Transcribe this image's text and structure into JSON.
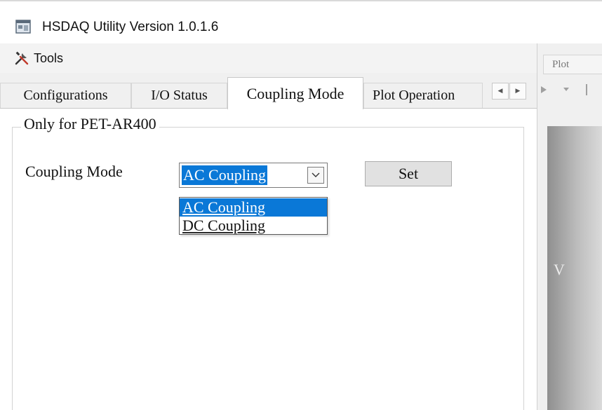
{
  "window": {
    "title": "HSDAQ Utility Version 1.0.1.6"
  },
  "menu": {
    "tools_label": "Tools"
  },
  "tabs": [
    {
      "label": "Configurations",
      "active": false
    },
    {
      "label": "I/O Status",
      "active": false
    },
    {
      "label": "Coupling Mode",
      "active": true
    },
    {
      "label": "Plot Operation",
      "active": false
    }
  ],
  "tab_scroll": {
    "left": "◀",
    "right": "▶"
  },
  "group": {
    "legend": "Only for PET-AR400"
  },
  "coupling": {
    "label": "Coupling Mode",
    "selected_value": "AC Coupling",
    "options": [
      "AC Coupling",
      "DC Coupling"
    ],
    "set_label": "Set"
  },
  "plot_pane": {
    "tab_label": "Plot",
    "axis_label": "V"
  },
  "colors": {
    "selection": "#0a78d7",
    "button_face": "#e1e1e1"
  }
}
